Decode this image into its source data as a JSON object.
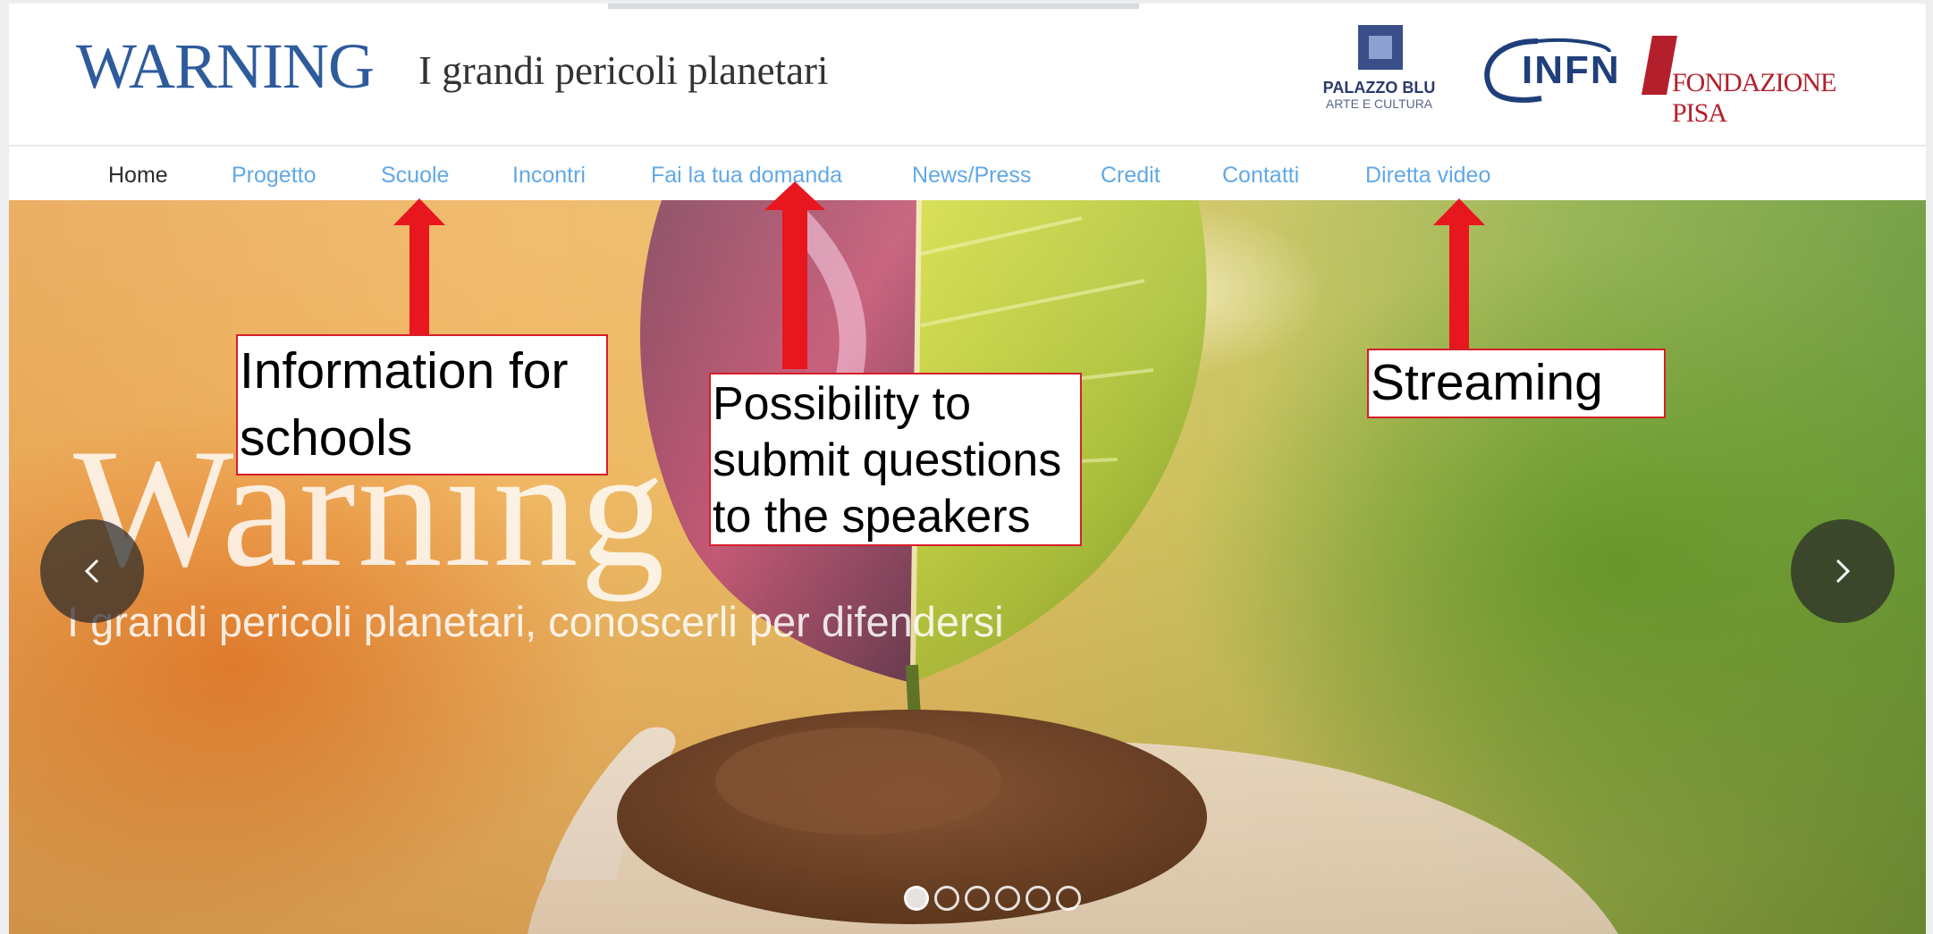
{
  "header": {
    "logo_text": "WARNING",
    "tagline": "I grandi pericoli planetari",
    "sponsors": {
      "palazzo_line1": "PALAZZO BLU",
      "palazzo_line2": "ARTE E CULTURA",
      "infn": "INFN",
      "fondazione": "FONDAZIONE PISA"
    }
  },
  "nav": {
    "items": [
      {
        "label": "Home"
      },
      {
        "label": "Progetto"
      },
      {
        "label": "Scuole"
      },
      {
        "label": "Incontri"
      },
      {
        "label": "Fai la tua domanda"
      },
      {
        "label": "News/Press"
      },
      {
        "label": "Credit"
      },
      {
        "label": "Contatti"
      },
      {
        "label": "Diretta video"
      }
    ],
    "active_index": 0
  },
  "hero": {
    "title": "Warning",
    "subtitle": "I grandi pericoli planetari, conoscerli per difendersi",
    "slide_count": 6,
    "active_slide": 0
  },
  "annotations": {
    "schools": [
      "Information for",
      "schools"
    ],
    "questions": [
      "Possibility to",
      "submit questions",
      "to the speakers"
    ],
    "streaming": "Streaming"
  },
  "colors": {
    "brand_blue": "#2e5b9c",
    "nav_link": "#62a8e6",
    "nav_active": "#2c2c2c",
    "annotation_red": "#d81e2a",
    "infn_blue": "#1f3f7a",
    "fondazione_red": "#b3202b"
  }
}
